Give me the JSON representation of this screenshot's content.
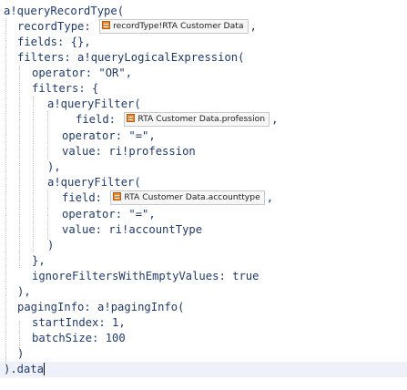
{
  "code": {
    "l1": "a!queryRecordType(",
    "l2_key": "recordType:",
    "l2_chip": "recordType!RTA Customer Data",
    "l2_tail": ",",
    "l3": "fields: {},",
    "l4": "filters: a!queryLogicalExpression(",
    "l5": "operator: \"OR\",",
    "l6": "filters: {",
    "l7": "a!queryFilter(",
    "l8_key": "field:",
    "l8_chip": "RTA Customer Data.profession",
    "l8_tail": ",",
    "l9": "operator: \"=\",",
    "l10": "value: ri!profession",
    "l11": "),",
    "l12": "a!queryFilter(",
    "l13_key": "field:",
    "l13_chip": "RTA Customer Data.accounttype",
    "l13_tail": ",",
    "l14": "operator: \"=\",",
    "l15": "value: ri!accountType",
    "l16": ")",
    "l17": "},",
    "l18": "ignoreFiltersWithEmptyValues: true",
    "l19": "),",
    "l20": "pagingInfo: a!pagingInfo(",
    "l21": "startIndex: 1,",
    "l22": "batchSize: 100",
    "l23": ")",
    "l24": ").data"
  },
  "icons": {
    "record": "record-type-icon"
  },
  "colors": {
    "code_text": "#1f3a6b",
    "chip_border": "#c9c9c9",
    "chip_bg": "#f7f7f7",
    "record_icon": "#e9862e",
    "active_line": "#eef0fa"
  }
}
